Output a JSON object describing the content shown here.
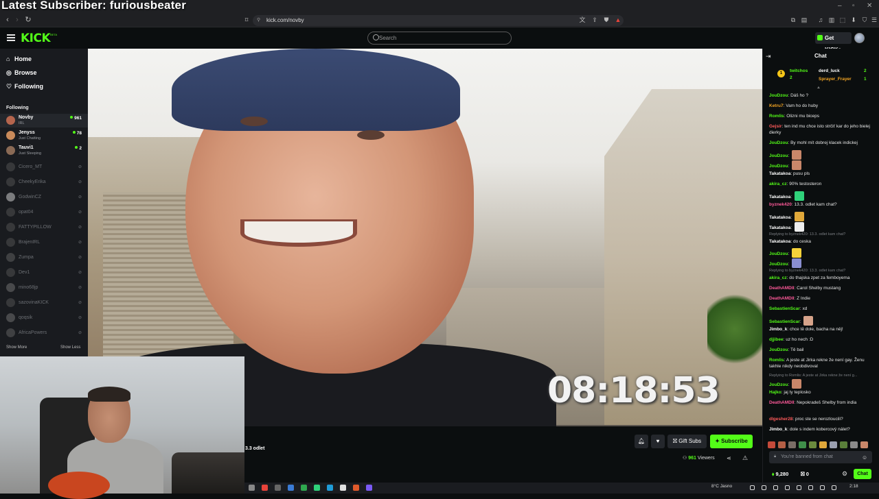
{
  "overlay": {
    "title": "Latest Subscriber: furiousbeater"
  },
  "browser": {
    "url": "kick.com/novby",
    "nav_back": "‹",
    "nav_fwd": "›",
    "nav_reload": "↻"
  },
  "header": {
    "logo": "KICK",
    "logo_badge": "BETA",
    "search_placeholder": "Search",
    "get_kicks_label": "Get KICKs"
  },
  "sidebar": {
    "nav": [
      {
        "label": "Home",
        "icon": "home-icon"
      },
      {
        "label": "Browse",
        "icon": "compass-icon"
      },
      {
        "label": "Following",
        "icon": "heart-icon"
      }
    ],
    "following_label": "Following",
    "channels": [
      {
        "name": "Novby",
        "category": "IRL",
        "viewers": "961",
        "live": true,
        "avatar_color": "#b5654d"
      },
      {
        "name": "Jenyss",
        "category": "Just Chatting",
        "viewers": "78",
        "live": true,
        "avatar_color": "#c98a5a"
      },
      {
        "name": "Tauvi1",
        "category": "Just Sleeping",
        "viewers": "2",
        "live": true,
        "avatar_color": "#8a6a55"
      },
      {
        "name": "Cicero_MT",
        "live": false,
        "avatar_color": "#555"
      },
      {
        "name": "CheekyErika",
        "live": false,
        "avatar_color": "#555"
      },
      {
        "name": "GodwinCZ",
        "live": false,
        "avatar_color": "#ddd"
      },
      {
        "name": "opat04",
        "live": false,
        "avatar_color": "#555"
      },
      {
        "name": "FATTYPILLOW",
        "live": false,
        "avatar_color": "#555"
      },
      {
        "name": "BrajenIRL",
        "live": false,
        "avatar_color": "#555"
      },
      {
        "name": "Zumpa",
        "live": false,
        "avatar_color": "#666"
      },
      {
        "name": "Dev1",
        "live": false,
        "avatar_color": "#555"
      },
      {
        "name": "mino68jp",
        "live": false,
        "avatar_color": "#777"
      },
      {
        "name": "sazovinaKICK",
        "live": false,
        "avatar_color": "#555"
      },
      {
        "name": "qoqsik",
        "live": false,
        "avatar_color": "#777"
      },
      {
        "name": "AfricaPowers",
        "live": false,
        "avatar_color": "#666"
      }
    ],
    "show_more": "Show More",
    "show_less": "Show Less"
  },
  "video": {
    "timer": "08:18:53",
    "stream_title": "3.3 odlet",
    "gift_subs_label": "Gift Subs",
    "subscribe_label": "Subscribe",
    "viewers_count": "961",
    "viewers_label": "Viewers"
  },
  "chat": {
    "title": "Chat",
    "pinned": [
      {
        "rank": "1",
        "name": "twitchos",
        "amount": "2"
      },
      {
        "name": "derd_luck",
        "amount": "2"
      },
      {
        "name": "Sprayer_Frayer",
        "amount": "1"
      }
    ],
    "messages": [
      {
        "user": "JouDzou",
        "color": "#53fc18",
        "text": "Dáš ho ?"
      },
      {
        "user": "Ketru7",
        "color": "#f5a623",
        "text": "Vam ho do huby"
      },
      {
        "user": "Romlis",
        "color": "#53fc18",
        "text": "Olizni mu biceps"
      },
      {
        "user": "Gejsir",
        "color": "#ff5a5a",
        "text": "ten ind mu chce isto strčiť kar do jeho bielej dierky"
      },
      {
        "user": "JouDzou",
        "color": "#53fc18",
        "text": "By mohl mít dobrej klacek indickej"
      },
      {
        "user": "JouDzou",
        "color": "#53fc18",
        "text": "",
        "emote": "#c9876a"
      },
      {
        "user": "JouDzou",
        "color": "#53fc18",
        "text": "",
        "emote": "#c9876a"
      },
      {
        "user": "Takatakoa",
        "color": "#ffffff",
        "text": "pusu pls"
      },
      {
        "user": "akira_cz",
        "color": "#53fc18",
        "text": "90% testosteron"
      },
      {
        "user": "Takatakoa",
        "color": "#ffffff",
        "text": "",
        "emote": "#2fd17a"
      },
      {
        "user": "byznek420",
        "color": "#ff5a9a",
        "text": "13.3. odlet kam chat?"
      },
      {
        "user": "Takatakoa",
        "color": "#ffffff",
        "text": "",
        "emote": "#e0a83a"
      },
      {
        "user": "Takatakoa",
        "color": "#ffffff",
        "text": "",
        "emote": "#eeeeee"
      },
      {
        "reply": "Replying to byznek420: 13.3. odlet kam chat?"
      },
      {
        "user": "Takatakoa",
        "color": "#ffffff",
        "text": "do ceska"
      },
      {
        "user": "JouDzou",
        "color": "#53fc18",
        "text": "",
        "emote": "#f5d23a"
      },
      {
        "user": "JouDzou",
        "color": "#53fc18",
        "text": "",
        "emote": "#8a8fd0"
      },
      {
        "reply": "Replying to byznek420: 13.3. odlet kam chat?"
      },
      {
        "user": "akira_cz",
        "color": "#53fc18",
        "text": "do thajska zpet za femboyema"
      },
      {
        "user": "DeathAMDII",
        "color": "#ff5a9a",
        "text": "Carol Shelby mustang"
      },
      {
        "user": "DeathAMDII",
        "color": "#ff5a9a",
        "text": "Z Indie"
      },
      {
        "user": "SebastienScar",
        "color": "#53fc18",
        "text": "xd"
      },
      {
        "user": "SebastienScar",
        "color": "#53fc18",
        "text": "",
        "emote": "#d6a38a"
      },
      {
        "user": "Jimbo_k",
        "color": "#ffffff",
        "text": "chce tě dole, bacha na něj!"
      },
      {
        "user": "djjibee",
        "color": "#53fc18",
        "text": "uz ho nech :D"
      },
      {
        "user": "JouDzou",
        "color": "#53fc18",
        "text": "Tě bail"
      },
      {
        "user": "Romlis",
        "color": "#53fc18",
        "text": "A jeste at Jirka rekne že není gay. Ženu takhle nikdy neobdivoval"
      },
      {
        "reply": "Replying to Romlis: A jeste at Jirka rekne že není g..."
      },
      {
        "user": "JouDzou",
        "color": "#53fc18",
        "text": "",
        "emote": "#c9876a"
      },
      {
        "user": "Hajko",
        "color": "#53fc18",
        "text": "jaj ty teplosko"
      },
      {
        "user": "DeathAMDII",
        "color": "#ff5a9a",
        "text": "Nepokradeš Shelby from india"
      },
      {
        "user": "dlgesher28",
        "color": "#ff5a5a",
        "text": "proc ste se nerozloucili?"
      },
      {
        "user": "Jimbo_k",
        "color": "#ffffff",
        "text": "dole s indem kobercový nálet?"
      }
    ],
    "input_placeholder": "You're banned from chat",
    "kicks_balance": "9,280",
    "gift_balance": "0",
    "send_label": "Chat"
  },
  "taskbar": {
    "weather": "8°C  Jasno",
    "time": "2:18"
  },
  "colors": {
    "accent": "#53fc18",
    "bg": "#0b0e0f",
    "panel": "#191b1f"
  }
}
